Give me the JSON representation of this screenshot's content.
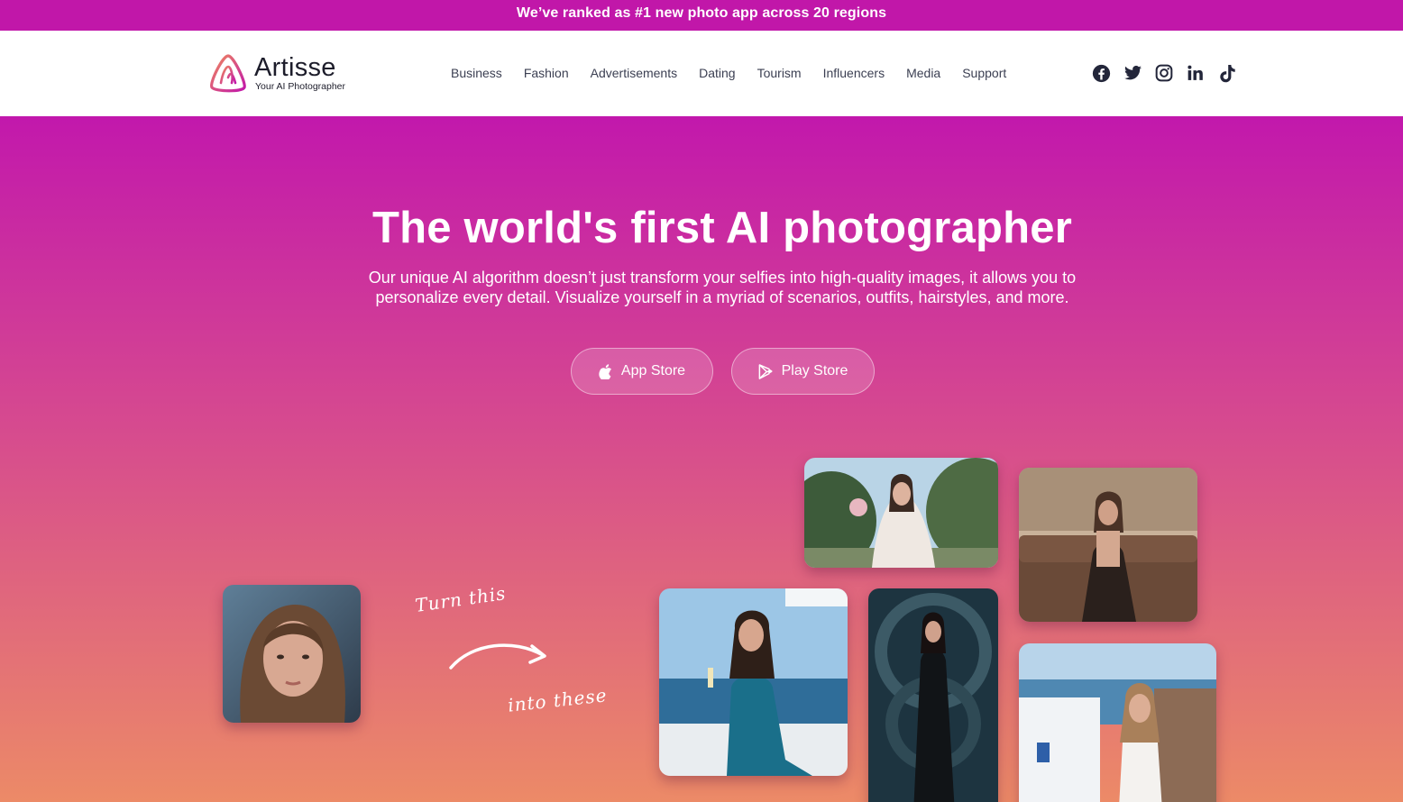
{
  "promo": {
    "text": "We’ve ranked as #1 new photo app across 20 regions"
  },
  "brand": {
    "name": "Artisse",
    "tagline": "Your AI Photographer",
    "accent": "#c117a9",
    "logo_gradient": [
      "#f08a5d",
      "#c117a9"
    ]
  },
  "nav": {
    "items": [
      "Business",
      "Fashion",
      "Advertisements",
      "Dating",
      "Tourism",
      "Influencers",
      "Media",
      "Support"
    ]
  },
  "social": {
    "icons": [
      "facebook-icon",
      "twitter-icon",
      "instagram-icon",
      "linkedin-icon",
      "tiktok-icon"
    ]
  },
  "hero": {
    "title": "The world's first AI photographer",
    "subtitle_line1": "Our unique AI algorithm doesn’t just transform your selfies into high-quality images, it allows you to",
    "subtitle_line2": "personalize every detail. Visualize yourself in a myriad of scenarios, outfits, hairstyles, and more.",
    "buttons": {
      "app_store": "App Store",
      "play_store": "Play Store"
    },
    "annotation_1": "Turn this",
    "annotation_2": "into these",
    "gradient": [
      "#c218ac",
      "#d64a8f",
      "#ec8a67"
    ]
  }
}
